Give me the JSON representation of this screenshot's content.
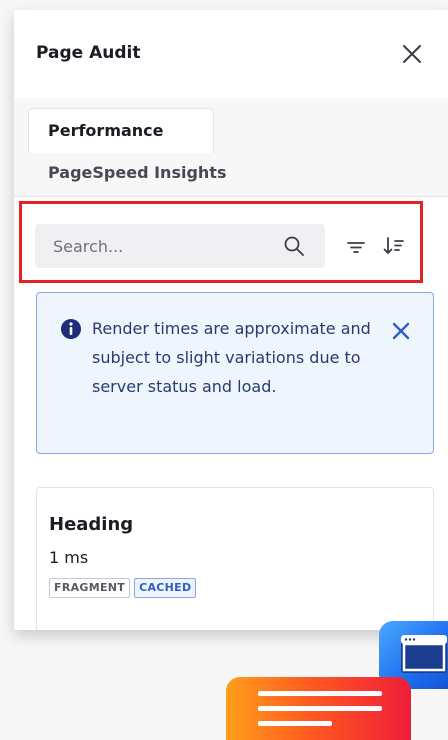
{
  "panel": {
    "title": "Page Audit",
    "close_icon": "close-icon"
  },
  "tabs": {
    "active_label": "Performance",
    "secondary_label": "PageSpeed Insights"
  },
  "toolbar": {
    "search_placeholder": "Search...",
    "search_icon": "search-icon",
    "filter_icon": "filter-icon",
    "sort_icon": "sort-icon",
    "highlight_color": "#e32222"
  },
  "alert": {
    "message": "Render times are approximate and subject to slight variations due to server status and load.",
    "icon": "info-icon",
    "close_icon": "close-icon",
    "accent_color": "#2f5fc4"
  },
  "results": [
    {
      "title": "Heading",
      "time": "1 ms",
      "badges": [
        "FRAGMENT",
        "CACHED"
      ]
    }
  ],
  "floating": {
    "app_icon": "browser-window-icon",
    "menu_icon": "menu-lines-icon"
  }
}
